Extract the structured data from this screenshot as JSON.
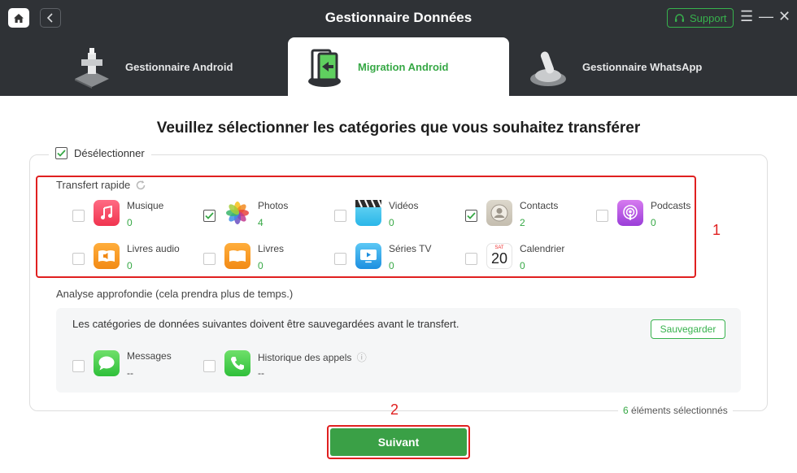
{
  "app": {
    "title": "Gestionnaire Données",
    "support_label": "Support"
  },
  "tabs": [
    {
      "label": "Gestionnaire Android",
      "icon": "android-manager-icon"
    },
    {
      "label": "Migration Android",
      "icon": "android-migration-icon",
      "active": true
    },
    {
      "label": "Gestionnaire WhatsApp",
      "icon": "whatsapp-manager-icon"
    }
  ],
  "main": {
    "heading": "Veuillez sélectionner les catégories que vous souhaitez transférer",
    "deselect_label": "Désélectionner",
    "quick_label": "Transfert rapide",
    "quick_categories": [
      {
        "name": "Musique",
        "count": "0",
        "checked": false,
        "icon": "music-icon"
      },
      {
        "name": "Photos",
        "count": "4",
        "checked": true,
        "icon": "photos-icon"
      },
      {
        "name": "Vidéos",
        "count": "0",
        "checked": false,
        "icon": "videos-icon"
      },
      {
        "name": "Contacts",
        "count": "2",
        "checked": true,
        "icon": "contacts-icon"
      },
      {
        "name": "Podcasts",
        "count": "0",
        "checked": false,
        "icon": "podcasts-icon"
      },
      {
        "name": "Livres audio",
        "count": "0",
        "checked": false,
        "icon": "audiobooks-icon"
      },
      {
        "name": "Livres",
        "count": "0",
        "checked": false,
        "icon": "books-icon"
      },
      {
        "name": "Séries TV",
        "count": "0",
        "checked": false,
        "icon": "tv-icon"
      },
      {
        "name": "Calendrier",
        "count": "0",
        "checked": false,
        "icon": "calendar-icon",
        "cal_month": "SAT",
        "cal_day": "20"
      }
    ],
    "deep_label": "Analyse approfondie (cela prendra plus de temps.)",
    "deep_note": "Les catégories de données suivantes doivent être sauvegardées avant le transfert.",
    "save_label": "Sauvegarder",
    "deep_categories": [
      {
        "name": "Messages",
        "count": "--",
        "checked": false,
        "icon": "messages-icon"
      },
      {
        "name": "Historique des appels",
        "count": "--",
        "checked": false,
        "icon": "phone-icon"
      }
    ],
    "selected_count": "6",
    "selected_text": " éléments sélectionnés",
    "next_label": "Suivant",
    "step_numbers": [
      "1",
      "2"
    ]
  },
  "colors": {
    "accent": "#36a845",
    "highlight": "#e02020",
    "topbar": "#2f3236"
  }
}
